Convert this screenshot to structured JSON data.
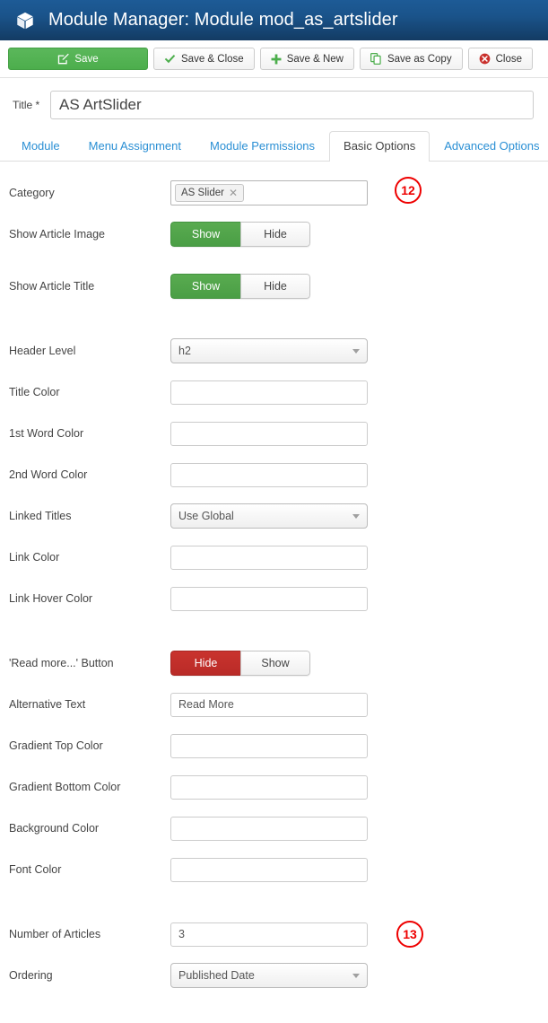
{
  "header": {
    "icon": "cube-icon",
    "title": "Module Manager: Module mod_as_artslider",
    "bg_gradient_top": "#1d5b96",
    "bg_gradient_bottom": "#133b63"
  },
  "toolbar": {
    "buttons": [
      {
        "label": "Save",
        "icon": "edit-square-icon",
        "style": "primary",
        "icon_color": "#ffffff"
      },
      {
        "label": "Save & Close",
        "icon": "check-icon",
        "style": "default",
        "icon_color": "#4cae4c"
      },
      {
        "label": "Save & New",
        "icon": "plus-icon",
        "style": "default",
        "icon_color": "#4cae4c"
      },
      {
        "label": "Save as Copy",
        "icon": "copy-icon",
        "style": "default",
        "icon_color": "#4cae4c"
      },
      {
        "label": "Close",
        "icon": "close-circle-icon",
        "style": "default",
        "icon_color": "#c9302c"
      }
    ]
  },
  "title_field": {
    "label": "Title *",
    "value": "AS ArtSlider",
    "placeholder": ""
  },
  "tabs": [
    {
      "label": "Module",
      "active": false
    },
    {
      "label": "Menu Assignment",
      "active": false
    },
    {
      "label": "Module Permissions",
      "active": false
    },
    {
      "label": "Basic Options",
      "active": true
    },
    {
      "label": "Advanced Options",
      "active": false
    }
  ],
  "fields": {
    "category": {
      "label": "Category",
      "chip": "AS Slider",
      "remove_icon": "close-x-icon"
    },
    "show_article_image": {
      "label": "Show Article Image",
      "on_label": "Show",
      "off_label": "Hide",
      "active": "Show",
      "active_color": "#4a9e45"
    },
    "show_article_title": {
      "label": "Show Article Title",
      "on_label": "Show",
      "off_label": "Hide",
      "active": "Show",
      "active_color": "#4a9e45"
    },
    "header_level": {
      "label": "Header Level",
      "value": "h2"
    },
    "title_color": {
      "label": "Title Color",
      "value": ""
    },
    "first_word_color": {
      "label": "1st Word Color",
      "value": ""
    },
    "second_word_color": {
      "label": "2nd Word Color",
      "value": ""
    },
    "linked_titles": {
      "label": "Linked Titles",
      "value": "Use Global"
    },
    "link_color": {
      "label": "Link Color",
      "value": ""
    },
    "link_hover_color": {
      "label": "Link Hover Color",
      "value": ""
    },
    "read_more_button": {
      "label": "'Read more...' Button",
      "on_label": "Hide",
      "off_label": "Show",
      "active": "Hide",
      "active_color": "#b92b27"
    },
    "alternative_text": {
      "label": "Alternative Text",
      "value": "Read More"
    },
    "gradient_top_color": {
      "label": "Gradient Top Color",
      "value": ""
    },
    "gradient_bottom_color": {
      "label": "Gradient Bottom Color",
      "value": ""
    },
    "background_color": {
      "label": "Background Color",
      "value": ""
    },
    "font_color": {
      "label": "Font Color",
      "value": ""
    },
    "number_of_articles": {
      "label": "Number of Articles",
      "value": "3"
    },
    "ordering": {
      "label": "Ordering",
      "value": "Published Date"
    }
  },
  "annotations": [
    {
      "number": "12",
      "color": "#ee0000"
    },
    {
      "number": "13",
      "color": "#ee0000"
    }
  ]
}
